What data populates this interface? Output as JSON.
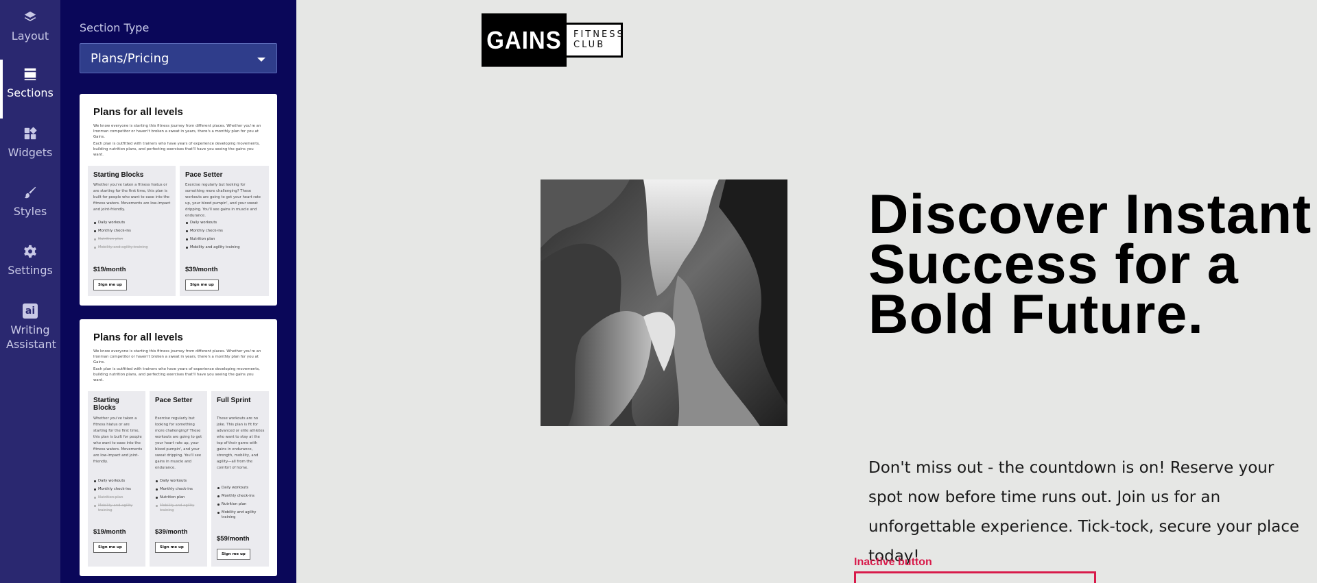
{
  "rail": {
    "items": [
      {
        "label": "Layout",
        "icon": "layers-icon"
      },
      {
        "label": "Sections",
        "icon": "sections-icon"
      },
      {
        "label": "Widgets",
        "icon": "widgets-icon"
      },
      {
        "label": "Styles",
        "icon": "brush-icon"
      },
      {
        "label": "Settings",
        "icon": "gear-icon"
      },
      {
        "label": "Writing Assistant",
        "icon": "ai-icon",
        "icon_text": "ai"
      }
    ],
    "active": "Sections"
  },
  "panel": {
    "section_type_label": "Section Type",
    "section_type_value": "Plans/Pricing",
    "cards": [
      {
        "title": "Plans for all levels",
        "intro": "We know everyone is starting this fitness journey from different places. Whether you're an Ironman competitor or haven't broken a sweat in years, there's a monthly plan for you at Gains.",
        "intro2": "Each plan is outfitted with trainers who have years of experience developing movements, building nutrition plans, and perfecting exercises that'll have you seeing the gains you want.",
        "plans": [
          {
            "name": "Starting Blocks",
            "desc": "Whether you've taken a fitness hiatus or are starting for the first time, this plan is built for people who want to ease into the fitness waters. Movements are low-impact and joint-friendly.",
            "features": [
              "Daily workouts",
              "Monthly check-ins",
              "Nutrition plan",
              "Mobility and agility training"
            ],
            "price": "$19/month",
            "button": "Sign me up"
          },
          {
            "name": "Pace Setter",
            "desc": "Exercise regularly but looking for something more challenging? These workouts are going to get your heart rate up, your blood pumpin', and your sweat dripping. You'll see gains in muscle and endurance.",
            "features": [
              "Daily workouts",
              "Monthly check-ins",
              "Nutrition plan",
              "Mobility and agility training"
            ],
            "price": "$39/month",
            "button": "Sign me up"
          }
        ]
      },
      {
        "title": "Plans for all levels",
        "intro": "We know everyone is starting this fitness journey from different places. Whether you're an Ironman competitor or haven't broken a sweat in years, there's a monthly plan for you at Gains.",
        "intro2": "Each plan is outfitted with trainers who have years of experience developing movements, building nutrition plans, and perfecting exercises that'll have you seeing the gains you want.",
        "plans": [
          {
            "name": "Starting Blocks",
            "desc": "Whether you've taken a fitness hiatus or are starting for the first time, this plan is built for people who want to ease into the fitness waters. Movements are low-impact and joint-friendly.",
            "features": [
              "Daily workouts",
              "Monthly check-ins",
              "Nutrition plan",
              "Mobility and agility training"
            ],
            "price": "$19/month",
            "button": "Sign me up"
          },
          {
            "name": "Pace Setter",
            "desc": "Exercise regularly but looking for something more challenging? These workouts are going to get your heart rate up, your blood pumpin', and your sweat dripping. You'll see gains in muscle and endurance.",
            "features": [
              "Daily workouts",
              "Monthly check-ins",
              "Nutrition plan",
              "Mobility and agility training"
            ],
            "price": "$39/month",
            "button": "Sign me up"
          },
          {
            "name": "Full Sprint",
            "desc": "These workouts are no joke. This plan is fit for advanced or elite athletes who want to stay at the top of their game with gains in endurance, strength, mobility, and agility—all from the comfort of home.",
            "features": [
              "Daily workouts",
              "Monthly check-ins",
              "Nutrition plan",
              "Mobility and agility training"
            ],
            "price": "$59/month",
            "button": "Sign me up"
          }
        ]
      }
    ]
  },
  "canvas": {
    "logo_left": "GAINS",
    "logo_right_line1": "FITNESS",
    "logo_right_line2": "CLUB",
    "headline": "Discover Instant Success for a Bold Future.",
    "body": "Don't miss out - the countdown is on! Reserve your spot now before time runs out. Join us for an unforgettable experience. Tick-tock, secure your place today!",
    "inactive_label": "Inactive button"
  },
  "colors": {
    "rail_bg": "#2a2870",
    "panel_bg": "#0a0759",
    "canvas_bg": "#e6e7e5",
    "accent_red": "#d81b4b"
  }
}
